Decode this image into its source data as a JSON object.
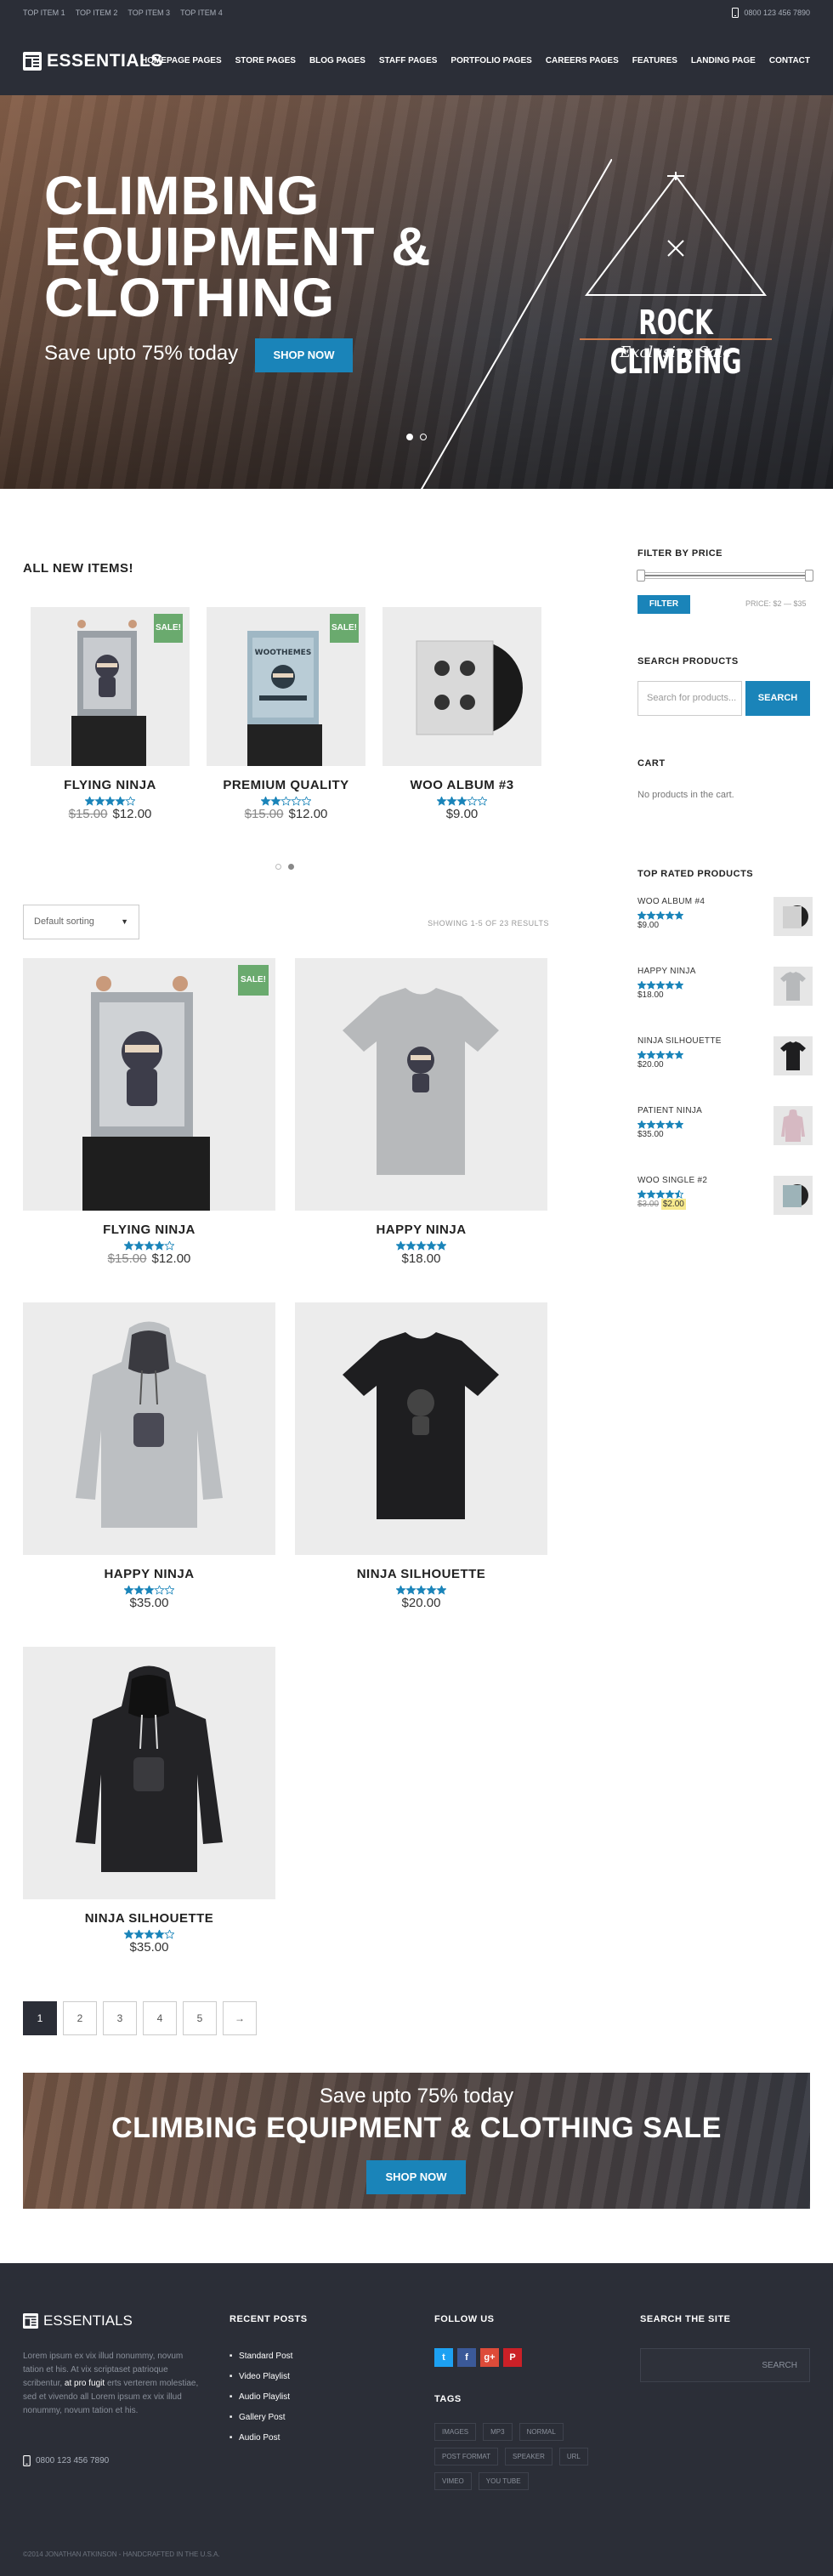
{
  "topbar": {
    "items": [
      "TOP ITEM 1",
      "TOP ITEM 2",
      "TOP ITEM 3",
      "TOP ITEM 4"
    ],
    "phone": "0800 123 456 7890"
  },
  "header": {
    "logo": "ESSENTIALS",
    "nav": [
      "HOMEPAGE PAGES",
      "STORE PAGES",
      "BLOG PAGES",
      "STAFF PAGES",
      "PORTFOLIO PAGES",
      "CAREERS PAGES",
      "FEATURES",
      "LANDING PAGE",
      "CONTACT"
    ]
  },
  "hero": {
    "title": "CLIMBING EQUIPMENT & CLOTHING",
    "subtitle": "Save upto 75% today",
    "button": "SHOP NOW",
    "badge_title": "ROCK CLIMBING",
    "badge_sub": "Exclusive Sale",
    "slides": 2,
    "active_slide": 1
  },
  "new_items": {
    "heading": "ALL NEW ITEMS!",
    "products": [
      {
        "name": "FLYING NINJA",
        "rating": 4,
        "old_price": "$15.00",
        "price": "$12.00",
        "sale": "SALE!"
      },
      {
        "name": "PREMIUM QUALITY",
        "rating": 2,
        "old_price": "$15.00",
        "price": "$12.00",
        "sale": "SALE!"
      },
      {
        "name": "WOO ALBUM #3",
        "rating": 3,
        "old_price": "",
        "price": "$9.00",
        "sale": ""
      }
    ]
  },
  "shop": {
    "sort": "Default sorting",
    "showing": "SHOWING 1-5 OF 23 RESULTS",
    "products": [
      {
        "name": "FLYING NINJA",
        "rating": 4,
        "old_price": "$15.00",
        "price": "$12.00",
        "sale": "SALE!"
      },
      {
        "name": "HAPPY NINJA",
        "rating": 5,
        "old_price": "",
        "price": "$18.00",
        "sale": ""
      },
      {
        "name": "HAPPY NINJA",
        "rating": 3,
        "old_price": "",
        "price": "$35.00",
        "sale": ""
      },
      {
        "name": "NINJA SILHOUETTE",
        "rating": 5,
        "old_price": "",
        "price": "$20.00",
        "sale": ""
      },
      {
        "name": "NINJA SILHOUETTE",
        "rating": 4,
        "old_price": "",
        "price": "$35.00",
        "sale": ""
      }
    ],
    "pages": [
      "1",
      "2",
      "3",
      "4",
      "5",
      "→"
    ]
  },
  "banner": {
    "line1": "Save upto 75% today",
    "line2": "CLIMBING EQUIPMENT & CLOTHING SALE",
    "button": "SHOP NOW"
  },
  "sidebar": {
    "filter": {
      "heading": "FILTER BY PRICE",
      "button": "FILTER",
      "price": "PRICE: $2 — $35"
    },
    "search": {
      "heading": "SEARCH PRODUCTS",
      "placeholder": "Search for products...",
      "button": "SEARCH"
    },
    "cart": {
      "heading": "CART",
      "empty": "No products in the cart."
    },
    "top_rated": {
      "heading": "TOP RATED PRODUCTS",
      "items": [
        {
          "name": "WOO ALBUM #4",
          "rating": 5,
          "old_price": "",
          "price": "$9.00"
        },
        {
          "name": "HAPPY NINJA",
          "rating": 5,
          "old_price": "",
          "price": "$18.00"
        },
        {
          "name": "NINJA SILHOUETTE",
          "rating": 5,
          "old_price": "",
          "price": "$20.00"
        },
        {
          "name": "PATIENT NINJA",
          "rating": 5,
          "old_price": "",
          "price": "$35.00"
        },
        {
          "name": "WOO SINGLE #2",
          "rating": 4.5,
          "old_price": "$3.00",
          "price": "$2.00"
        }
      ]
    }
  },
  "footer": {
    "logo": "ESSENTIALS",
    "about_1": "Lorem ipsum ex vix illud nonummy, novum tation et his. At vix scriptaset patrioque scribentur, ",
    "about_link": "at pro fugit",
    "about_2": " erts verterem molestiae, sed et vivendo all Lorem ipsum ex vix illud nonummy, novum tation et his.",
    "phone": "0800 123 456 7890",
    "recent_heading": "RECENT POSTS",
    "recent": [
      "Standard Post",
      "Video Playlist",
      "Audio Playlist",
      "Gallery Post",
      "Audio Post"
    ],
    "follow_heading": "FOLLOW US",
    "social": [
      {
        "icon": "twitter-icon",
        "glyph": "t",
        "color": "#1da1f2"
      },
      {
        "icon": "facebook-icon",
        "glyph": "f",
        "color": "#3b5998"
      },
      {
        "icon": "googleplus-icon",
        "glyph": "g+",
        "color": "#dd4b39"
      },
      {
        "icon": "pinterest-icon",
        "glyph": "P",
        "color": "#cb2027"
      }
    ],
    "tags_heading": "TAGS",
    "tags": [
      "IMAGES",
      "MP3",
      "NORMAL",
      "POST FORMAT",
      "SPEAKER",
      "URL",
      "VIMEO",
      "YOU TUBE"
    ],
    "search_heading": "SEARCH THE SITE",
    "search_button": "SEARCH",
    "copyright": "©2014 JONATHAN ATKINSON - HANDCRAFTED IN THE U.S.A."
  },
  "colors": {
    "accent": "#1a84b9",
    "dark": "#2b2e37",
    "sale": "#6aaa6e",
    "star": "#1a84b9"
  }
}
